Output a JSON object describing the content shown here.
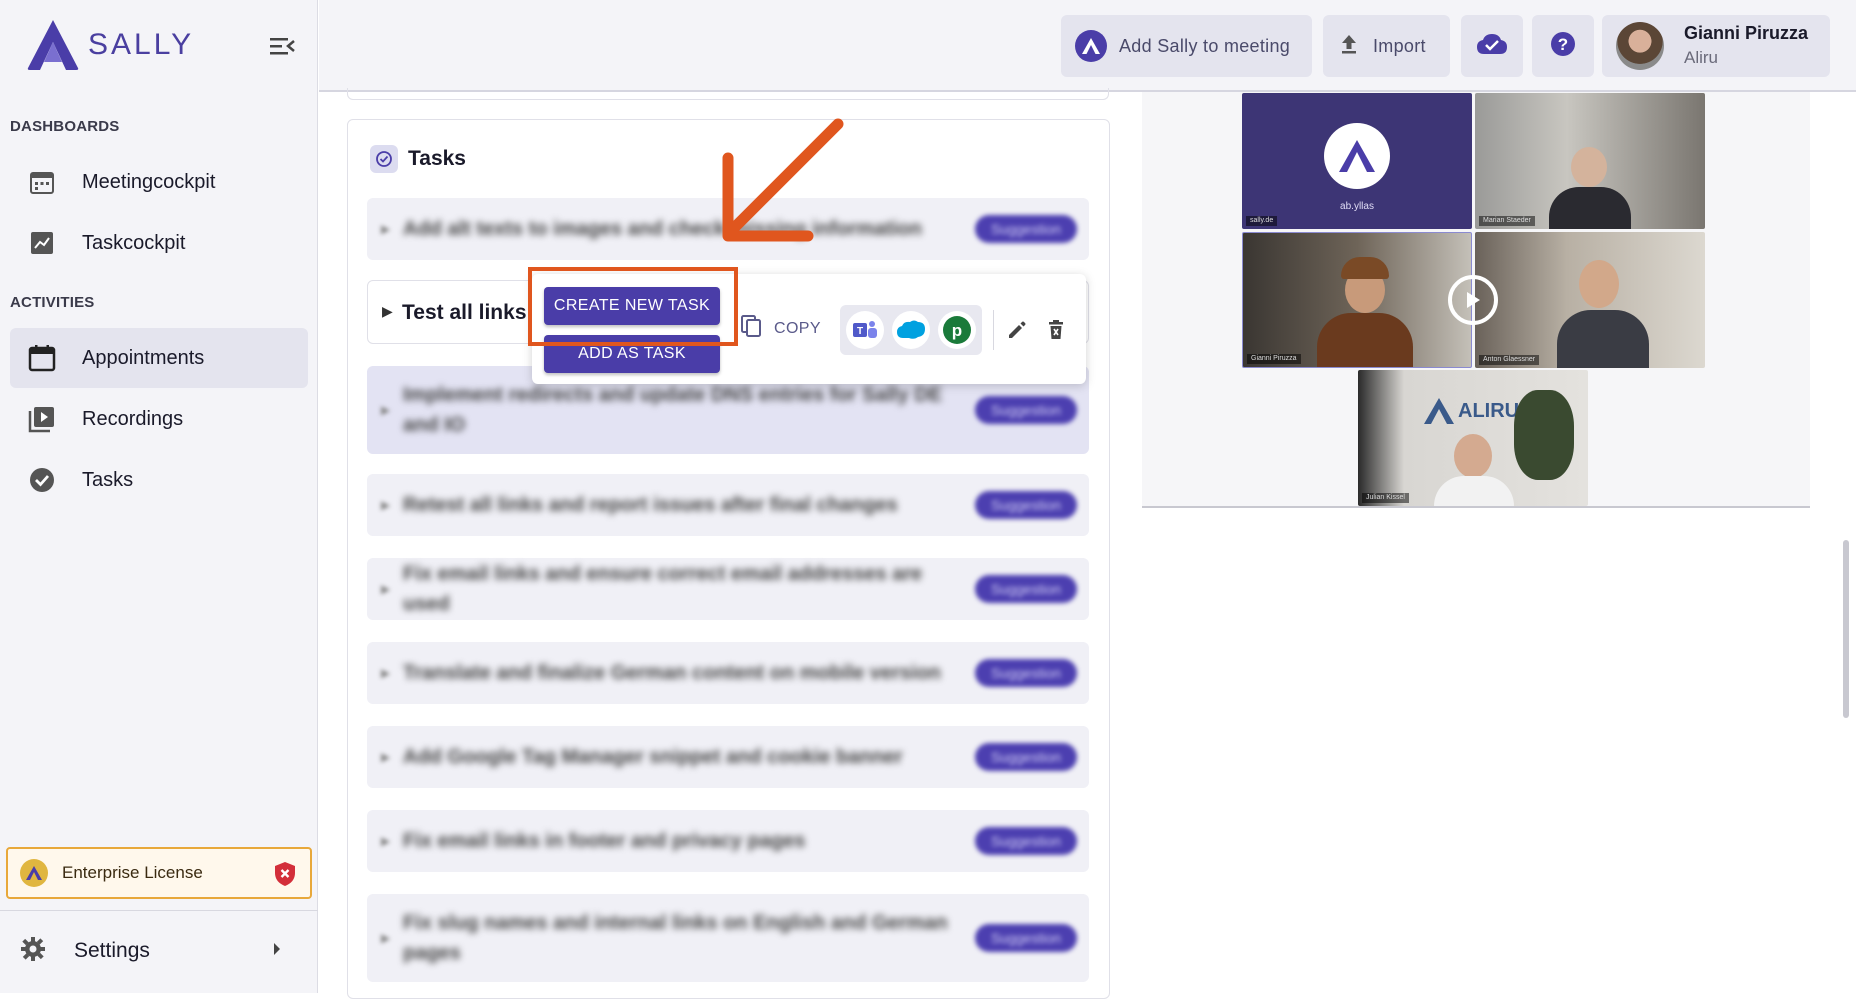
{
  "app": {
    "logo_text": "SALLY",
    "brand_color": "#4a3da8"
  },
  "sidebar": {
    "dashboards_label": "DASHBOARDS",
    "activities_label": "ACTIVITIES",
    "dashboards": [
      {
        "label": "Meetingcockpit",
        "icon": "calendar-grid-icon"
      },
      {
        "label": "Taskcockpit",
        "icon": "chart-icon"
      }
    ],
    "activities": [
      {
        "label": "Appointments",
        "icon": "calendar-icon",
        "active": true
      },
      {
        "label": "Recordings",
        "icon": "video-library-icon",
        "active": false
      },
      {
        "label": "Tasks",
        "icon": "check-circle-icon",
        "active": false
      }
    ],
    "license_label": "Enterprise License",
    "settings_label": "Settings"
  },
  "topbar": {
    "add_sally_label": "Add Sally to meeting",
    "import_label": "Import",
    "user_name": "Gianni Piruzza",
    "user_org": "Aliru"
  },
  "tasks": {
    "title": "Tasks",
    "focused_task": "Test all links a",
    "popup": {
      "create_new_task": "CREATE NEW TASK",
      "add_as_task": "ADD AS TASK",
      "copy": "COPY",
      "integrations": [
        "teams-icon",
        "salesforce-icon",
        "pipedrive-icon"
      ]
    },
    "suggestion_badge": "Suggestion",
    "rows": [
      {
        "text": "Add alt texts to images and check missing information"
      },
      {
        "text": "Implement redirects and update DNS entries for Sally DE and IO"
      },
      {
        "text": "Retest all links and report issues after final changes"
      },
      {
        "text": "Fix email links and ensure correct email addresses are used"
      },
      {
        "text": "Translate and finalize German content on mobile version"
      },
      {
        "text": "Add Google Tag Manager snippet and cookie banner"
      },
      {
        "text": "Fix email links in footer and privacy pages"
      },
      {
        "text": "Fix slug names and internal links on English and German pages"
      }
    ]
  },
  "video": {
    "tiles": [
      {
        "label": "sally.de",
        "logo_caption": "ab.yllas"
      },
      {
        "label": "Marian Staeder"
      },
      {
        "label": "Gianni Piruzza"
      },
      {
        "label": "Anton Glaessner"
      },
      {
        "label": "Julian Kissel",
        "brand": "ALIRU"
      }
    ]
  },
  "colors": {
    "accent": "#4a3da8",
    "annotation": "#e0561e",
    "license_border": "#e8a83a"
  }
}
